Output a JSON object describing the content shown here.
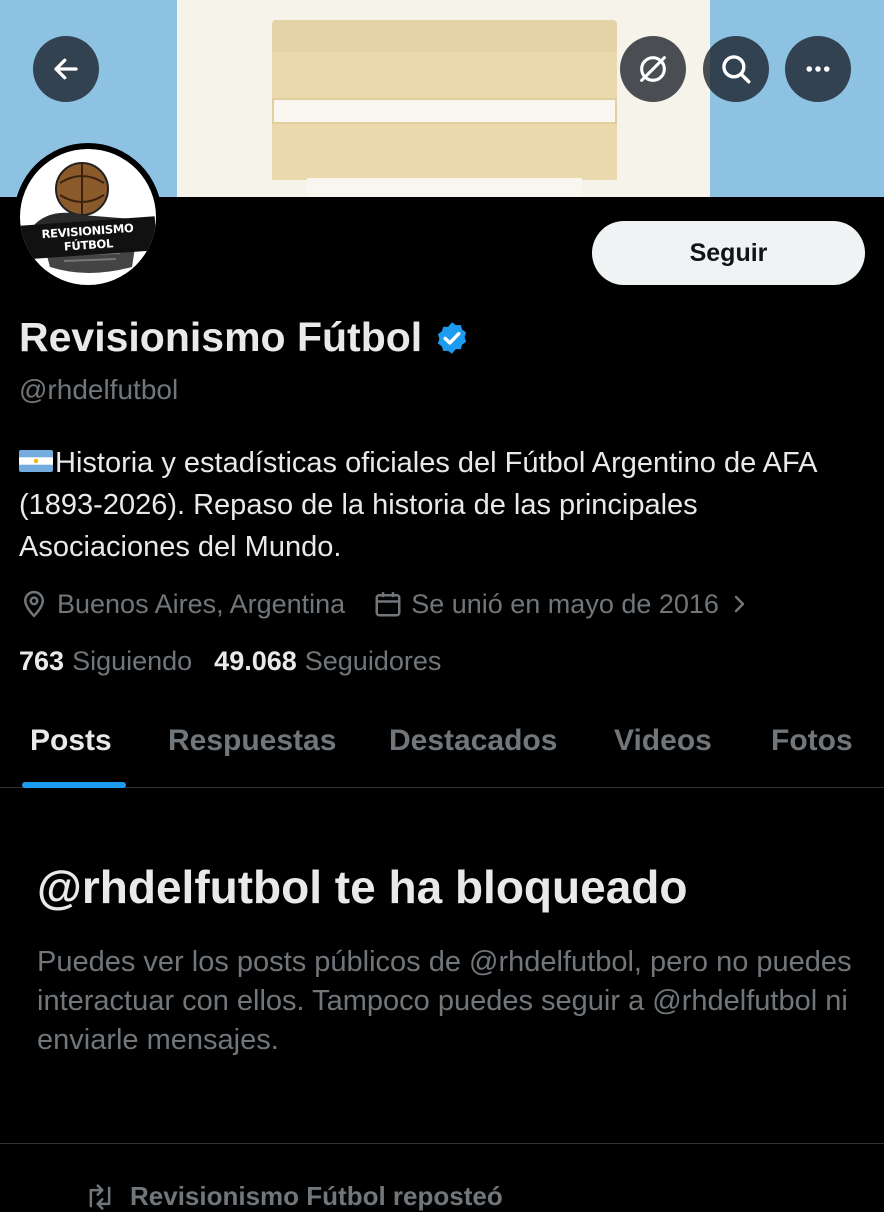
{
  "profile": {
    "display_name": "Revisionismo Fútbol",
    "handle": "@rhdelfutbol",
    "avatar_text": "REVISIONISMO FÚTBOL",
    "bio": "Historia y estadísticas oficiales del Fútbol Argentino de AFA (1893-2026). Repaso de la historia de las principales Asociaciones del Mundo.",
    "location": "Buenos Aires, Argentina",
    "joined": "Se unió en mayo de 2016",
    "following_count": "763",
    "following_label": "Siguiendo",
    "followers_count": "49.068",
    "followers_label": "Seguidores",
    "verified_color": "#1d9bf0"
  },
  "actions": {
    "follow_label": "Seguir"
  },
  "tabs": [
    {
      "label": "Posts",
      "active": true
    },
    {
      "label": "Respuestas",
      "active": false
    },
    {
      "label": "Destacados",
      "active": false
    },
    {
      "label": "Videos",
      "active": false
    },
    {
      "label": "Fotos",
      "active": false
    }
  ],
  "blocked": {
    "title": "@rhdelfutbol te ha bloqueado",
    "description": "Puedes ver los posts públicos de @rhdelfutbol, pero no puedes interactuar con ellos. Tampoco puedes seguir a @rhdelfutbol ni enviarle mensajes."
  },
  "feed": {
    "repost_text": "Revisionismo Fútbol reposteó"
  },
  "icons": {
    "back": "arrow-left-icon",
    "hide": "eye-slash-icon",
    "search": "search-icon",
    "more": "more-icon",
    "location": "location-pin-icon",
    "calendar": "calendar-icon",
    "repost": "repost-icon"
  },
  "colors": {
    "background": "#000000",
    "text_primary": "#e7e9ea",
    "text_secondary": "#71767b",
    "accent": "#1d9bf0",
    "banner_sky": "#8ec2e3"
  }
}
